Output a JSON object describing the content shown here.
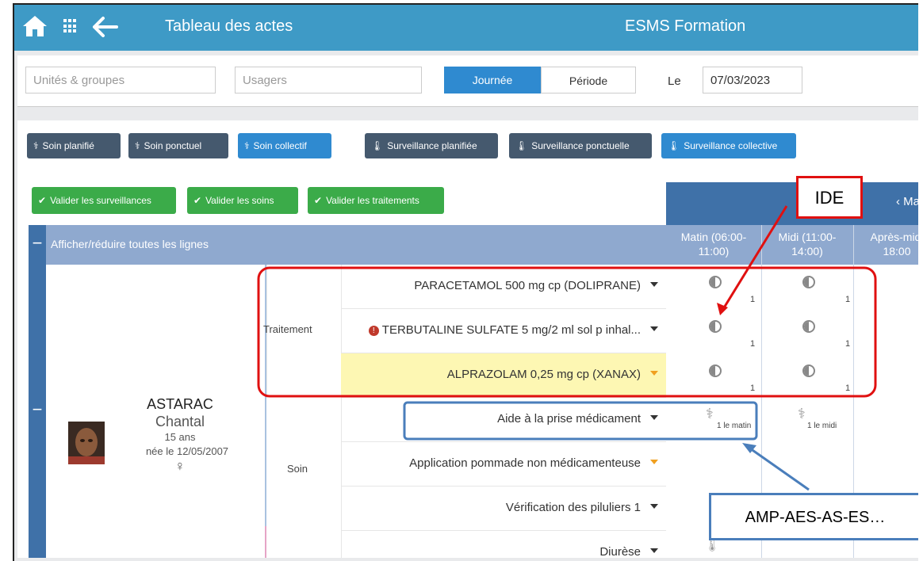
{
  "header": {
    "title": "Tableau des actes",
    "brand": "ESMS Formation"
  },
  "filters": {
    "units_placeholder": "Unités & groupes",
    "users_placeholder": "Usagers",
    "mode_day": "Journée",
    "mode_period": "Période",
    "date_label": "Le",
    "date_value": "07/03/2023"
  },
  "action_buttons": {
    "soin_planifie": "Soin planifié",
    "soin_ponctuel": "Soin ponctuel",
    "soin_collectif": "Soin collectif",
    "surv_planifiee": "Surveillance planifiée",
    "surv_ponctuelle": "Surveillance ponctuelle",
    "surv_collective": "Surveillance collective"
  },
  "validate_buttons": {
    "surveillances": "Valider les surveillances",
    "soins": "Valider les soins",
    "traitements": "Valider les traitements"
  },
  "table": {
    "toggle_all": "Afficher/réduire toutes les lignes",
    "day_nav": "‹  Ma",
    "columns": {
      "matin_l1": "Matin (06:00-",
      "matin_l2": "11:00)",
      "midi_l1": "Midi (11:00-",
      "midi_l2": "14:00)",
      "apres_l1": "Après-midi",
      "apres_l2": "18:00"
    }
  },
  "patient": {
    "last_name": "ASTARAC",
    "first_name": "Chantal",
    "age": "15 ans",
    "birth": "née le 12/05/2007",
    "sex_symbol": "♀"
  },
  "groups": {
    "traitement": "Traitement",
    "soin": "Soin"
  },
  "treatments": [
    {
      "name": "PARACETAMOL 500 mg cp (DOLIPRANE)",
      "matin": "1",
      "midi": "1"
    },
    {
      "name": "TERBUTALINE SULFATE 5 mg/2 ml sol p inhal...",
      "matin": "1",
      "midi": "1"
    },
    {
      "name": "ALPRAZOLAM 0,25 mg cp (XANAX)",
      "matin": "1",
      "midi": "1"
    }
  ],
  "soins": [
    {
      "name": "Aide à la prise médicament",
      "matin": "1 le matin",
      "midi": "1 le midi"
    },
    {
      "name": "Application pommade non médicamenteuse"
    },
    {
      "name": "Vérification des piluliers 1"
    }
  ],
  "surveillance": [
    {
      "name": "Diurèse"
    }
  ],
  "annotations": {
    "ide": "IDE",
    "amp": "AMP-AES-AS-ES…"
  },
  "colors": {
    "topbar": "#3e9ac6",
    "dark_button": "#45596e",
    "blue_button": "#2f8ad0",
    "green_button": "#3bab49",
    "header_band": "#8fa9cf",
    "header_dark": "#3f71a8",
    "highlight_row": "#fdf7b3",
    "ide_annotation": "#e01010",
    "amp_annotation": "#4a7ebb"
  }
}
